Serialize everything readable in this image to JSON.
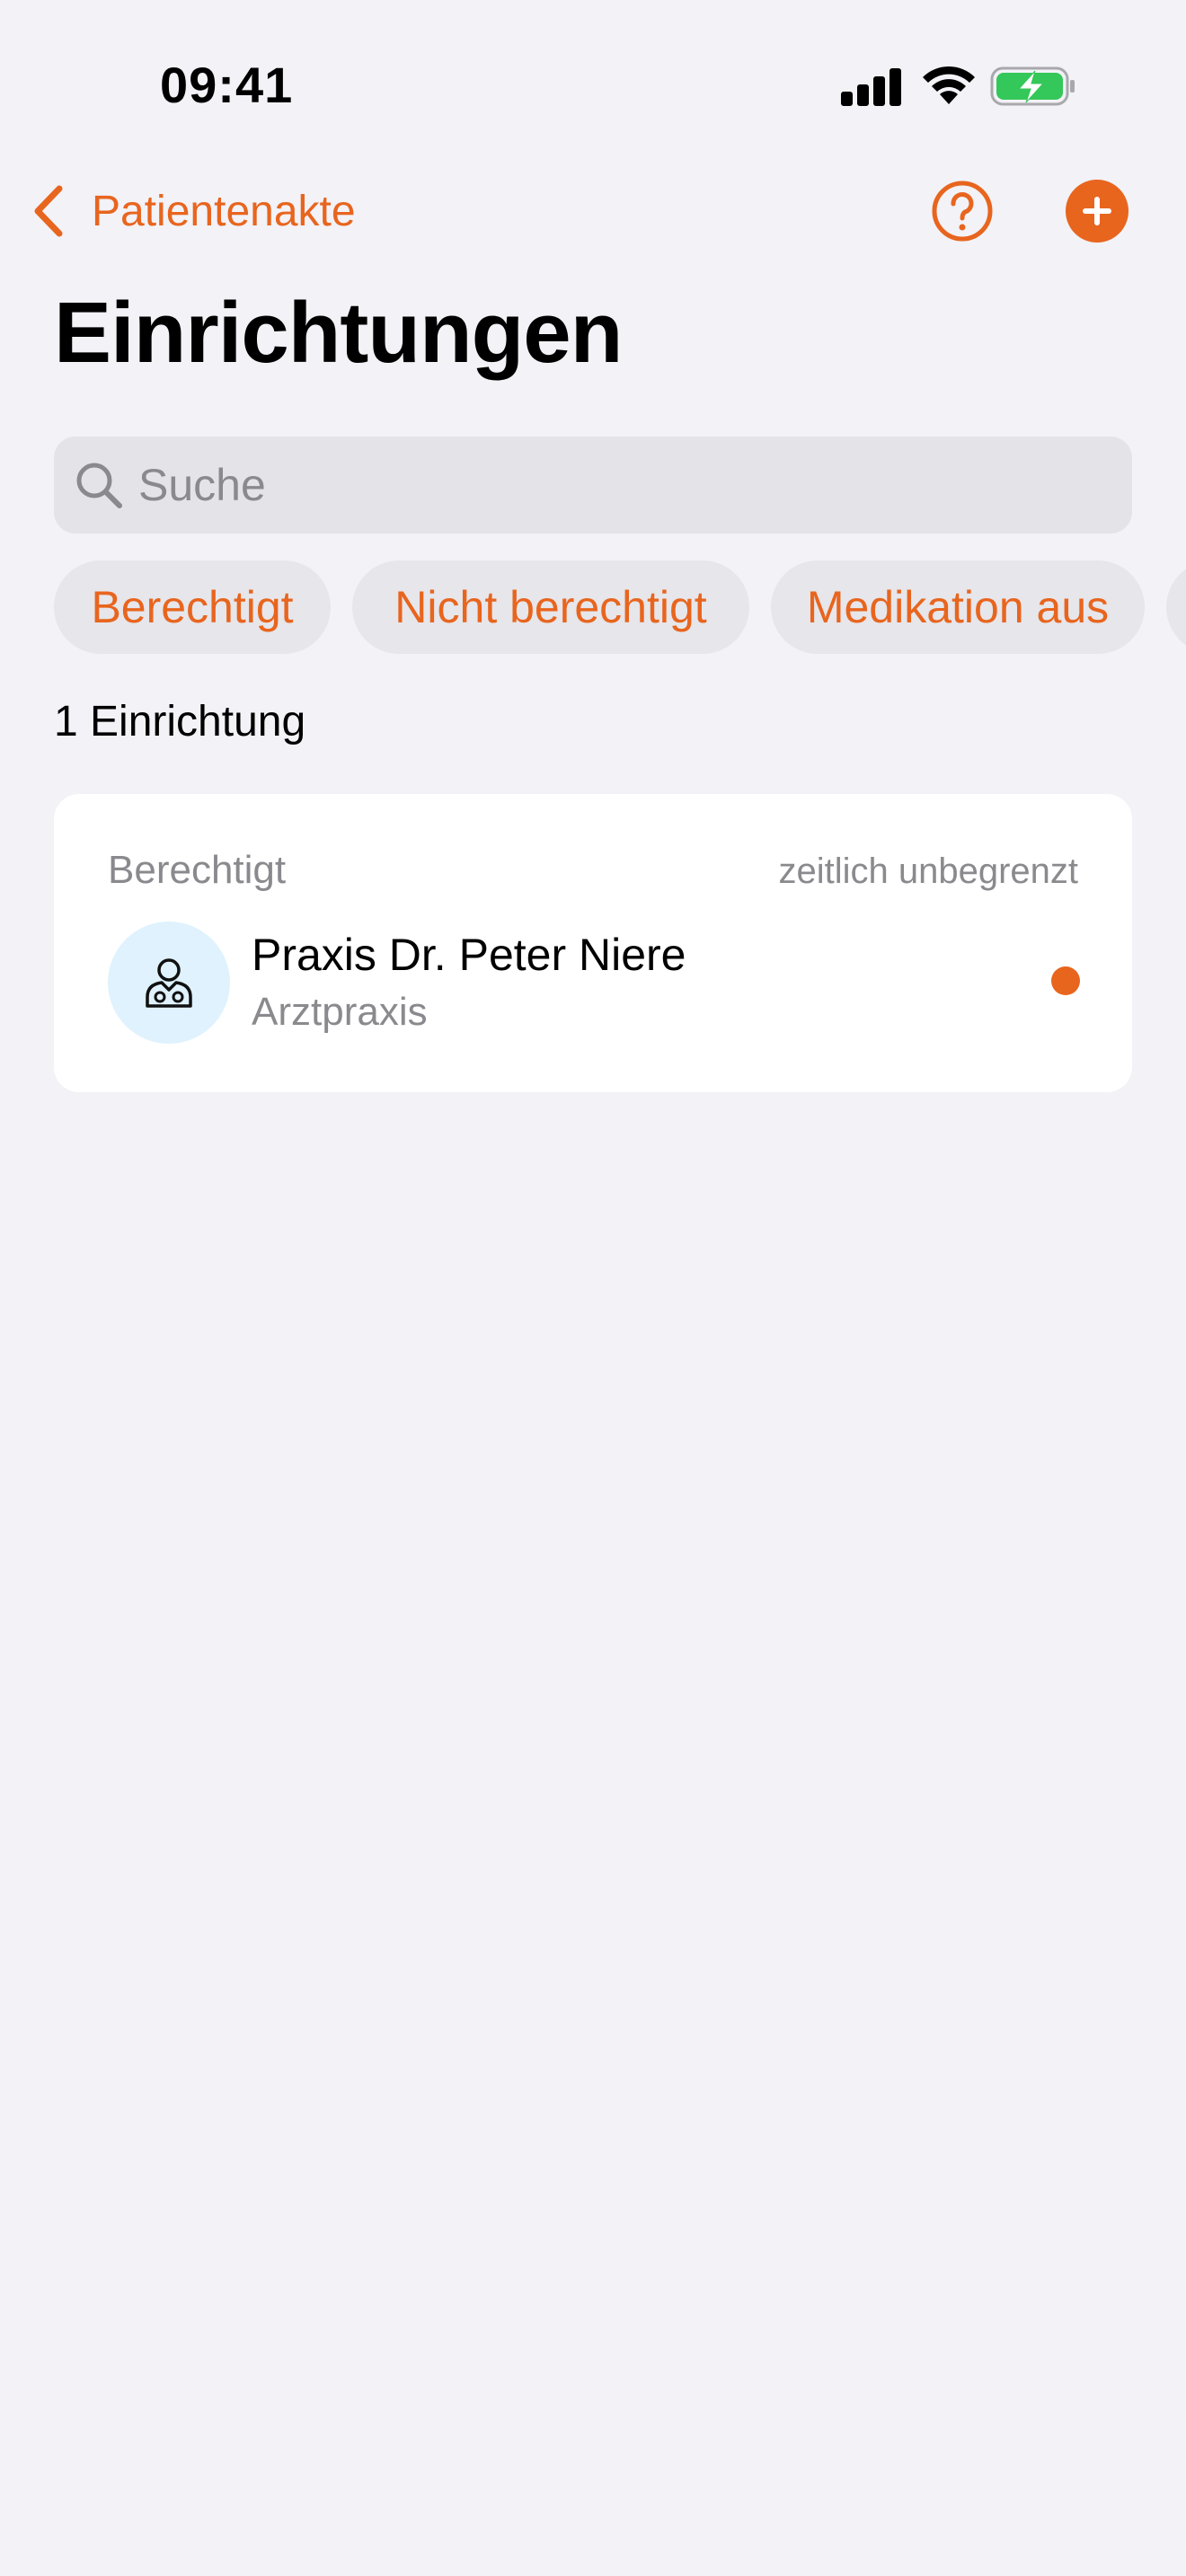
{
  "status_bar": {
    "time": "09:41"
  },
  "nav": {
    "back_label": "Patientenakte",
    "accent_color": "#e8651e"
  },
  "page_title": "Einrichtungen",
  "search": {
    "placeholder": "Suche",
    "value": ""
  },
  "filters": [
    {
      "label": "Berechtigt"
    },
    {
      "label": "Nicht berechtigt"
    },
    {
      "label": "Medikation aus"
    }
  ],
  "count_label": "1 Einrichtung",
  "institutions": [
    {
      "status": "Berechtigt",
      "duration": "zeitlich unbegrenzt",
      "name": "Praxis Dr. Peter Niere",
      "type": "Arztpraxis",
      "icon": "doctor-icon",
      "indicator_color": "#e8651e"
    }
  ]
}
